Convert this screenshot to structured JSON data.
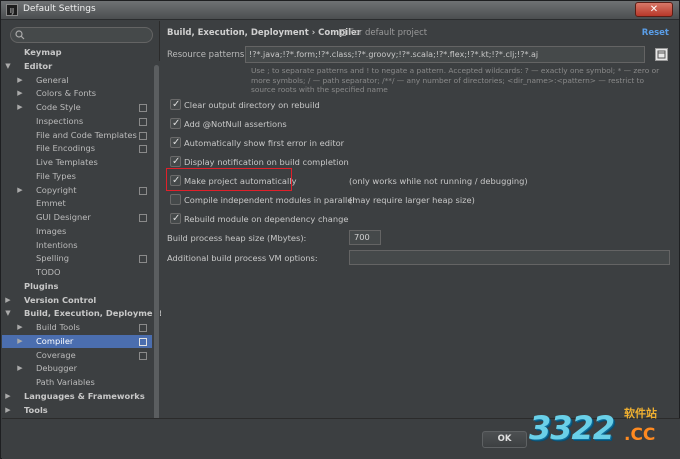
{
  "window": {
    "title": "Default Settings",
    "app_icon_text": "IJ",
    "close_symbol": "✕"
  },
  "sidebar": {
    "search_placeholder": "",
    "items": [
      {
        "label": "Keymap",
        "bold": true,
        "level": 0,
        "arrow": ""
      },
      {
        "label": "Editor",
        "bold": true,
        "level": 0,
        "arrow": "▼"
      },
      {
        "label": "General",
        "level": 1,
        "arrow": "▶"
      },
      {
        "label": "Colors & Fonts",
        "level": 1,
        "arrow": "▶"
      },
      {
        "label": "Code Style",
        "level": 1,
        "arrow": "▶",
        "copy": true
      },
      {
        "label": "Inspections",
        "level": 1,
        "arrow": "",
        "copy": true
      },
      {
        "label": "File and Code Templates",
        "level": 1,
        "arrow": "",
        "copy": true
      },
      {
        "label": "File Encodings",
        "level": 1,
        "arrow": "",
        "copy": true
      },
      {
        "label": "Live Templates",
        "level": 1,
        "arrow": ""
      },
      {
        "label": "File Types",
        "level": 1,
        "arrow": ""
      },
      {
        "label": "Copyright",
        "level": 1,
        "arrow": "▶",
        "copy": true
      },
      {
        "label": "Emmet",
        "level": 1,
        "arrow": ""
      },
      {
        "label": "GUI Designer",
        "level": 1,
        "arrow": "",
        "copy": true
      },
      {
        "label": "Images",
        "level": 1,
        "arrow": ""
      },
      {
        "label": "Intentions",
        "level": 1,
        "arrow": ""
      },
      {
        "label": "Spelling",
        "level": 1,
        "arrow": "",
        "copy": true
      },
      {
        "label": "TODO",
        "level": 1,
        "arrow": ""
      },
      {
        "label": "Plugins",
        "bold": true,
        "level": 0,
        "arrow": ""
      },
      {
        "label": "Version Control",
        "bold": true,
        "level": 0,
        "arrow": "▶"
      },
      {
        "label": "Build, Execution, Deployment",
        "bold": true,
        "level": 0,
        "arrow": "▼"
      },
      {
        "label": "Build Tools",
        "level": 1,
        "arrow": "▶",
        "copy": true
      },
      {
        "label": "Compiler",
        "level": 1,
        "arrow": "▶",
        "copy": true,
        "selected": true
      },
      {
        "label": "Coverage",
        "level": 1,
        "arrow": "",
        "copy": true
      },
      {
        "label": "Debugger",
        "level": 1,
        "arrow": "▶"
      },
      {
        "label": "Path Variables",
        "level": 1,
        "arrow": ""
      },
      {
        "label": "Languages & Frameworks",
        "bold": true,
        "level": 0,
        "arrow": "▶"
      },
      {
        "label": "Tools",
        "bold": true,
        "level": 0,
        "arrow": "▶"
      }
    ]
  },
  "main": {
    "breadcrumb": "Build, Execution, Deployment › Compiler",
    "for_default": "For default project",
    "reset": "Reset",
    "resource_patterns_label": "Resource patterns:",
    "resource_patterns_value": "!?*.java;!?*.form;!?*.class;!?*.groovy;!?*.scala;!?*.flex;!?*.kt;!?*.clj;!?*.aj",
    "hint": "Use ; to separate patterns and ! to negate a pattern. Accepted wildcards: ? — exactly one symbol; * — zero or more symbols; / — path separator; /**/ — any number of directories; <dir_name>:<pattern> — restrict to source roots with the specified name",
    "options": [
      {
        "label": "Clear output directory on rebuild",
        "checked": true,
        "note": ""
      },
      {
        "label": "Add @NotNull assertions",
        "checked": true,
        "note": ""
      },
      {
        "label": "Automatically show first error in editor",
        "checked": true,
        "note": ""
      },
      {
        "label": "Display notification on build completion",
        "checked": true,
        "note": ""
      },
      {
        "label": "Make project automatically",
        "checked": true,
        "note": "(only works while not running / debugging)"
      },
      {
        "label": "Compile independent modules in parallel",
        "checked": false,
        "note": "(may require larger heap size)"
      },
      {
        "label": "Rebuild module on dependency change",
        "checked": true,
        "note": ""
      }
    ],
    "heap_label": "Build process heap size (Mbytes):",
    "heap_value": "700",
    "vm_label": "Additional build process VM options:",
    "vm_value": ""
  },
  "footer": {
    "ok": "OK"
  },
  "watermark": {
    "number": "3322",
    "cn": "软件站",
    "cc": ".CC"
  }
}
